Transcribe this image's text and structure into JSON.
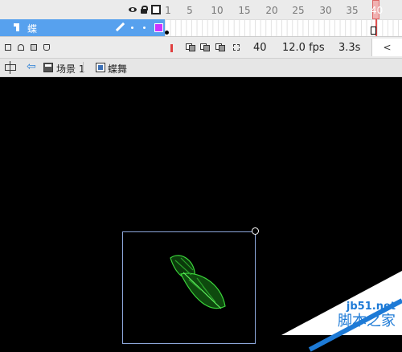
{
  "timeline": {
    "ruler_labels": [
      "1",
      "5",
      "10",
      "15",
      "20",
      "25",
      "30",
      "35",
      "40"
    ],
    "current_frame_marker": "40",
    "layer": {
      "name": "蝶",
      "color": "#cc33ff"
    },
    "current_frame": "40",
    "fps": "12.0 fps",
    "elapsed": "3.3s",
    "scroll_glyph": "<"
  },
  "edit_bar": {
    "back_glyph": "⇦",
    "breadcrumbs": [
      "场景 1",
      "蝶舞"
    ]
  },
  "watermark": {
    "url": "jb51.net",
    "text": "脚本之家"
  },
  "colors": {
    "layer_highlight": "#57a1ee",
    "playhead": "#e05050",
    "stage": "#000000",
    "butterfly": "#3bd43b"
  }
}
